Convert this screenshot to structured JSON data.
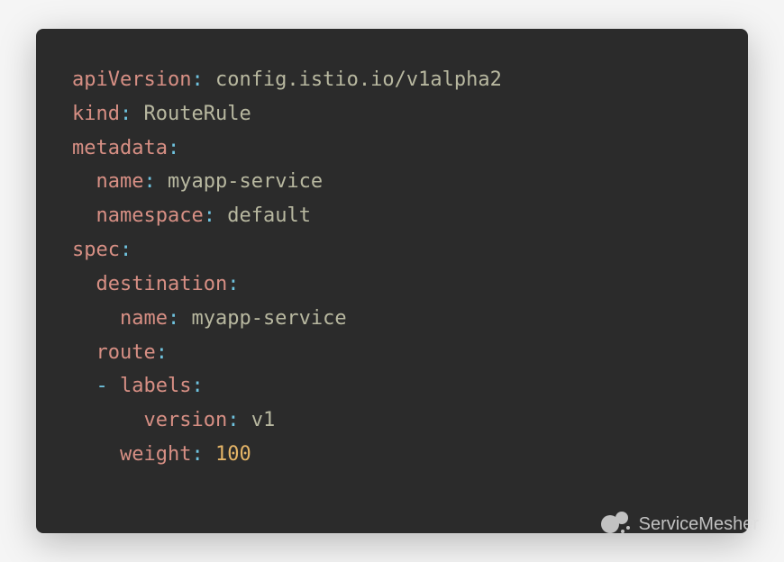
{
  "code": {
    "lines": [
      {
        "indent": 0,
        "key": "apiVersion",
        "value": "config.istio.io/v1alpha2",
        "valueType": "string"
      },
      {
        "indent": 0,
        "key": "kind",
        "value": "RouteRule",
        "valueType": "string"
      },
      {
        "indent": 0,
        "key": "metadata",
        "value": "",
        "valueType": "none"
      },
      {
        "indent": 1,
        "key": "name",
        "value": "myapp-service",
        "valueType": "string"
      },
      {
        "indent": 1,
        "key": "namespace",
        "value": "default",
        "valueType": "string"
      },
      {
        "indent": 0,
        "key": "spec",
        "value": "",
        "valueType": "none"
      },
      {
        "indent": 1,
        "key": "destination",
        "value": "",
        "valueType": "none"
      },
      {
        "indent": 2,
        "key": "name",
        "value": "myapp-service",
        "valueType": "string"
      },
      {
        "indent": 1,
        "key": "route",
        "value": "",
        "valueType": "none"
      },
      {
        "indent": 1,
        "dash": true,
        "key": "labels",
        "value": "",
        "valueType": "none"
      },
      {
        "indent": 3,
        "key": "version",
        "value": "v1",
        "valueType": "string"
      },
      {
        "indent": 2,
        "key": "weight",
        "value": "100",
        "valueType": "num"
      }
    ]
  },
  "watermark": {
    "text": "ServiceMesher"
  }
}
